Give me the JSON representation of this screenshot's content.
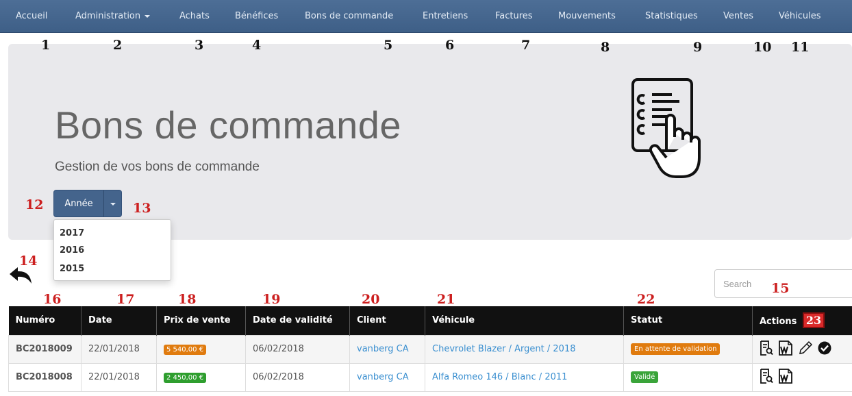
{
  "nav": {
    "items": [
      {
        "label": "Accueil"
      },
      {
        "label": "Administration"
      },
      {
        "label": "Achats"
      },
      {
        "label": "Bénéfices"
      },
      {
        "label": "Bons de commande"
      },
      {
        "label": "Entretiens"
      },
      {
        "label": "Factures"
      },
      {
        "label": "Mouvements"
      },
      {
        "label": "Statistiques"
      },
      {
        "label": "Ventes"
      },
      {
        "label": "Véhicules"
      }
    ]
  },
  "markers": [
    "1",
    "2",
    "3",
    "4",
    "5",
    "6",
    "7",
    "8",
    "9",
    "10",
    "11",
    "12",
    "13",
    "14",
    "15",
    "16",
    "17",
    "18",
    "19",
    "20",
    "21",
    "22",
    "23"
  ],
  "header": {
    "title": "Bons de commande",
    "subtitle": "Gestion de vos bons de commande",
    "icon": "checklist-hand-icon"
  },
  "year_filter": {
    "label": "Année",
    "options": [
      "2017",
      "2016",
      "2015"
    ]
  },
  "search": {
    "placeholder": "Search"
  },
  "table": {
    "columns": [
      "Numéro",
      "Date",
      "Prix de vente",
      "Date de validité",
      "Client",
      "Véhicule",
      "Statut",
      "Actions"
    ],
    "rows": [
      {
        "numero": "BC2018009",
        "date": "22/01/2018",
        "prix": "5 540,00 €",
        "validite": "06/02/2018",
        "client": "vanberg CA",
        "vehicule": "Chevrolet Blazer / Argent / 2018",
        "statut": "En attente de validation"
      },
      {
        "numero": "BC2018008",
        "date": "22/01/2018",
        "prix": "2 450,00 €",
        "validite": "06/02/2018",
        "client": "vanberg CA",
        "vehicule": "Alfa Romeo 146 / Blanc / 2011",
        "statut": "Validé"
      }
    ]
  },
  "colors": {
    "navbar": "#46678f",
    "button": "#44648c",
    "price_orange": "#e07b0e",
    "price_green": "#2e9e2e",
    "status_orange": "#e07b0e",
    "status_green": "#3aa43a",
    "link": "#3a8fd0",
    "header_bg": "#111111"
  }
}
